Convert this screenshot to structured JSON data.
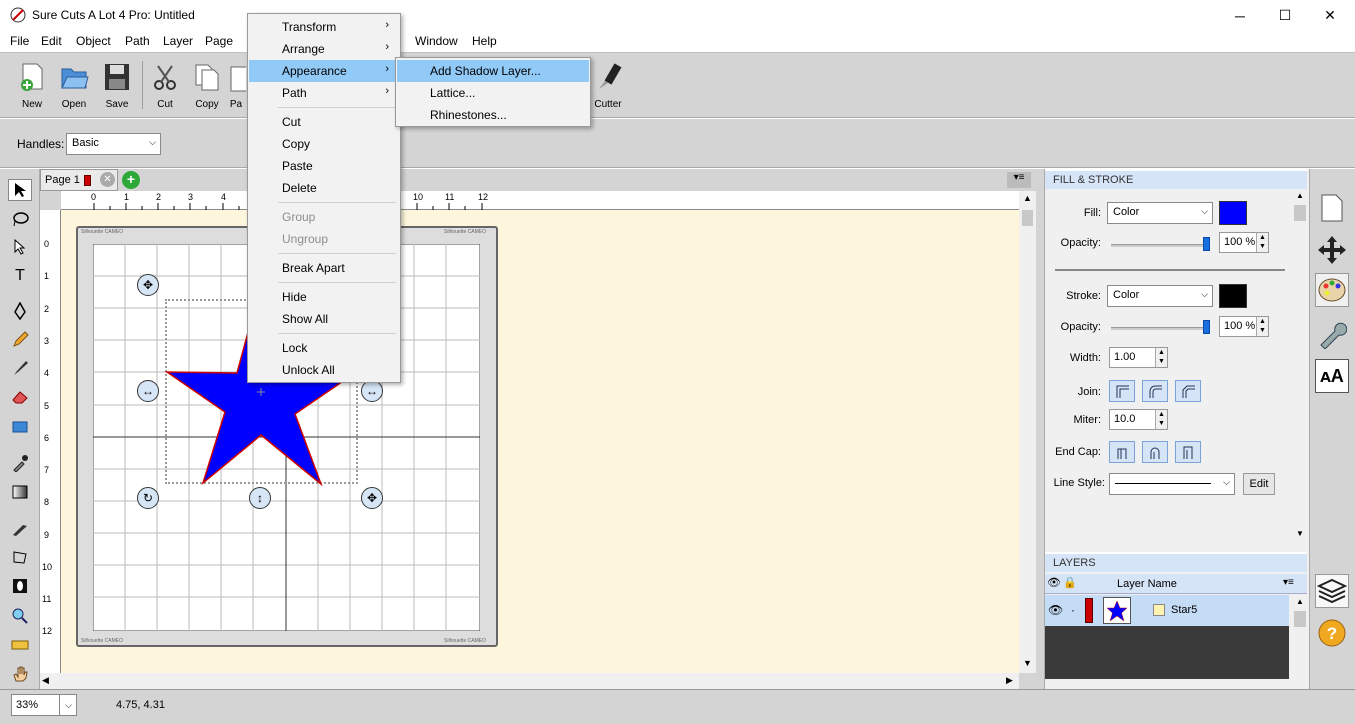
{
  "window": {
    "title": "Sure Cuts A Lot 4 Pro: Untitled",
    "minimize": "─",
    "maximize": "☐",
    "close": "✕"
  },
  "menubar": [
    "File",
    "Edit",
    "Object",
    "Path",
    "Layer",
    "Page",
    "Window",
    "Help"
  ],
  "toolbar": {
    "new": "New",
    "open": "Open",
    "save": "Save",
    "cut": "Cut",
    "copy": "Copy",
    "paste": "Pa",
    "cutter": "Cutter"
  },
  "handles": {
    "label": "Handles:",
    "value": "Basic"
  },
  "page_tab": {
    "label": "Page 1"
  },
  "ruler": {
    "h": [
      "0",
      "1",
      "2",
      "3",
      "4",
      "10",
      "11",
      "12"
    ],
    "v": [
      "0",
      "1",
      "2",
      "3",
      "4",
      "5",
      "6",
      "7",
      "8",
      "9",
      "10",
      "11",
      "12"
    ]
  },
  "mat": {
    "corner_text": "Silhouette CAMEO"
  },
  "context_menu": {
    "items": [
      "Transform",
      "Arrange",
      "Appearance",
      "Path",
      "Cut",
      "Copy",
      "Paste",
      "Delete",
      "Group",
      "Ungroup",
      "Break Apart",
      "Hide",
      "Show All",
      "Lock",
      "Unlock All"
    ]
  },
  "submenu": {
    "items": [
      "Add Shadow Layer...",
      "Lattice...",
      "Rhinestones..."
    ]
  },
  "fill_stroke": {
    "title": "FILL & STROKE",
    "fill_label": "Fill:",
    "fill_type": "Color",
    "fill_color": "#0000ff",
    "opacity_label": "Opacity:",
    "fill_opacity": "100 %",
    "stroke_label": "Stroke:",
    "stroke_type": "Color",
    "stroke_color": "#000000",
    "stroke_opacity": "100 %",
    "width_label": "Width:",
    "width": "1.00",
    "join_label": "Join:",
    "miter_label": "Miter:",
    "miter": "10.0",
    "endcap_label": "End Cap:",
    "linestyle_label": "Line Style:",
    "edit": "Edit"
  },
  "layers": {
    "title": "LAYERS",
    "col_name": "Layer Name",
    "rows": [
      {
        "name": "Star5",
        "color": "#cc0000"
      }
    ]
  },
  "status": {
    "zoom": "33%",
    "coords": "4.75, 4.31"
  },
  "colors": {
    "star": "#0000ff",
    "star_outline": "#cc0000",
    "panel_header": "#d6e4f7",
    "highlight": "#91c9f7"
  }
}
